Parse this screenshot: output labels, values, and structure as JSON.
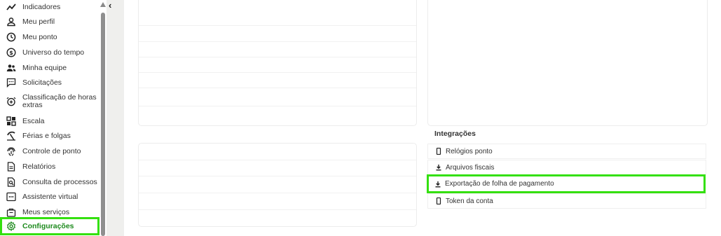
{
  "sidebar": {
    "items": [
      {
        "label": "Indicadores",
        "icon": "trend-line-icon"
      },
      {
        "label": "Meu perfil",
        "icon": "person-icon"
      },
      {
        "label": "Meu ponto",
        "icon": "clock-icon"
      },
      {
        "label": "Universo do tempo",
        "icon": "dollar-circle-icon"
      },
      {
        "label": "Minha equipe",
        "icon": "people-icon"
      },
      {
        "label": "Solicitações",
        "icon": "chat-dots-icon"
      },
      {
        "label": "Classificação de horas extras",
        "icon": "alarm-plus-icon"
      },
      {
        "label": "Escala",
        "icon": "grid-icon"
      },
      {
        "label": "Férias e folgas",
        "icon": "beach-icon"
      },
      {
        "label": "Controle de ponto",
        "icon": "fingerprint-icon"
      },
      {
        "label": "Relatórios",
        "icon": "document-icon"
      },
      {
        "label": "Consulta de processos",
        "icon": "document-search-icon"
      },
      {
        "label": "Assistente virtual",
        "icon": "chat-bot-icon"
      },
      {
        "label": "Meus serviços",
        "icon": "bag-icon"
      },
      {
        "label": "Configurações",
        "icon": "gear-icon",
        "active": true
      }
    ]
  },
  "integrations": {
    "title": "Integrações",
    "items": [
      {
        "label": "Relógios ponto",
        "icon": "phone-icon"
      },
      {
        "label": "Arquivos fiscais",
        "icon": "download-icon"
      },
      {
        "label": "Exportação de folha de pagamento",
        "icon": "download-icon",
        "highlighted": true
      },
      {
        "label": "Token da conta",
        "icon": "phone-icon"
      }
    ]
  },
  "colors": {
    "accent": "#34e00f",
    "active_text": "#1d8a1d",
    "gutter": "#efefed"
  }
}
